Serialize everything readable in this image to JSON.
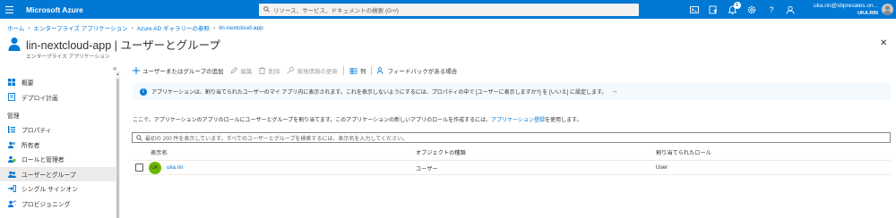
{
  "topbar": {
    "brand": "Microsoft Azure",
    "search_placeholder": "リソース、サービス、ドキュメントの検索 (G+/)",
    "notification_count": "1",
    "account_email": "uka.rin@sbpresales.on...",
    "account_tenant": "UKA.RIN",
    "icons": [
      "cloud-shell-icon",
      "directory-filter-icon",
      "notifications-icon",
      "settings-icon",
      "help-icon",
      "feedback-icon"
    ]
  },
  "breadcrumb": {
    "items": [
      "ホーム",
      "エンタープライズ アプリケーション",
      "Azure AD ギャラリーの参照",
      "lin-nextcloud-app"
    ]
  },
  "header": {
    "title": "lin-nextcloud-app | ユーザーとグループ",
    "subtitle": "エンタープライズ アプリケーション",
    "more": "…",
    "close": "✕"
  },
  "sidebar": {
    "collapse": "«",
    "items_top": [
      {
        "label": "概要",
        "icon": "overview-icon"
      },
      {
        "label": "デプロイ計画",
        "icon": "deployment-plan-icon"
      }
    ],
    "section": "管理",
    "items_manage": [
      {
        "label": "プロパティ",
        "icon": "properties-icon"
      },
      {
        "label": "所有者",
        "icon": "owners-icon"
      },
      {
        "label": "ロールと管理者",
        "icon": "roles-icon"
      },
      {
        "label": "ユーザーとグループ",
        "icon": "users-groups-icon",
        "active": true
      },
      {
        "label": "シングル サインオン",
        "icon": "sso-icon"
      },
      {
        "label": "プロビジョニング",
        "icon": "provisioning-icon"
      }
    ]
  },
  "toolbar": {
    "add": "ユーザーまたはグループの追加",
    "edit": "編集",
    "delete": "削除",
    "update_credentials": "資格情報の更新",
    "columns": "列",
    "feedback": "フィードバックがある場合"
  },
  "info": {
    "text": "アプリケーションは、割り当てられたユーザーのマイ アプリ内に表示されます。これを表示しないようにするには、プロパティの中で [ユーザーに表示しますか?] を [いいえ] に設定します。",
    "arrow": "→"
  },
  "description": {
    "text": "ここで、アプリケーションのアプリのロールにユーザーとグループを割り当てます。このアプリケーションの新しいアプリのロールを作成するには、",
    "link": "アプリケーション登録",
    "suffix": "を使用します。"
  },
  "filter": {
    "placeholder": "最初の 200 件を表示しています。すべてのユーザーとグループを検索するには、表示名を入力してください。"
  },
  "table": {
    "headers": [
      "表示名",
      "オブジェクトの種類",
      "割り当てられたロール"
    ],
    "rows": [
      {
        "initials": "UK",
        "name": "uka.rin",
        "type": "ユーザー",
        "role": "User"
      }
    ]
  },
  "colors": {
    "accent": "#0078d4",
    "avatar": "#6bb700",
    "info_bg": "#f3f9fd"
  }
}
